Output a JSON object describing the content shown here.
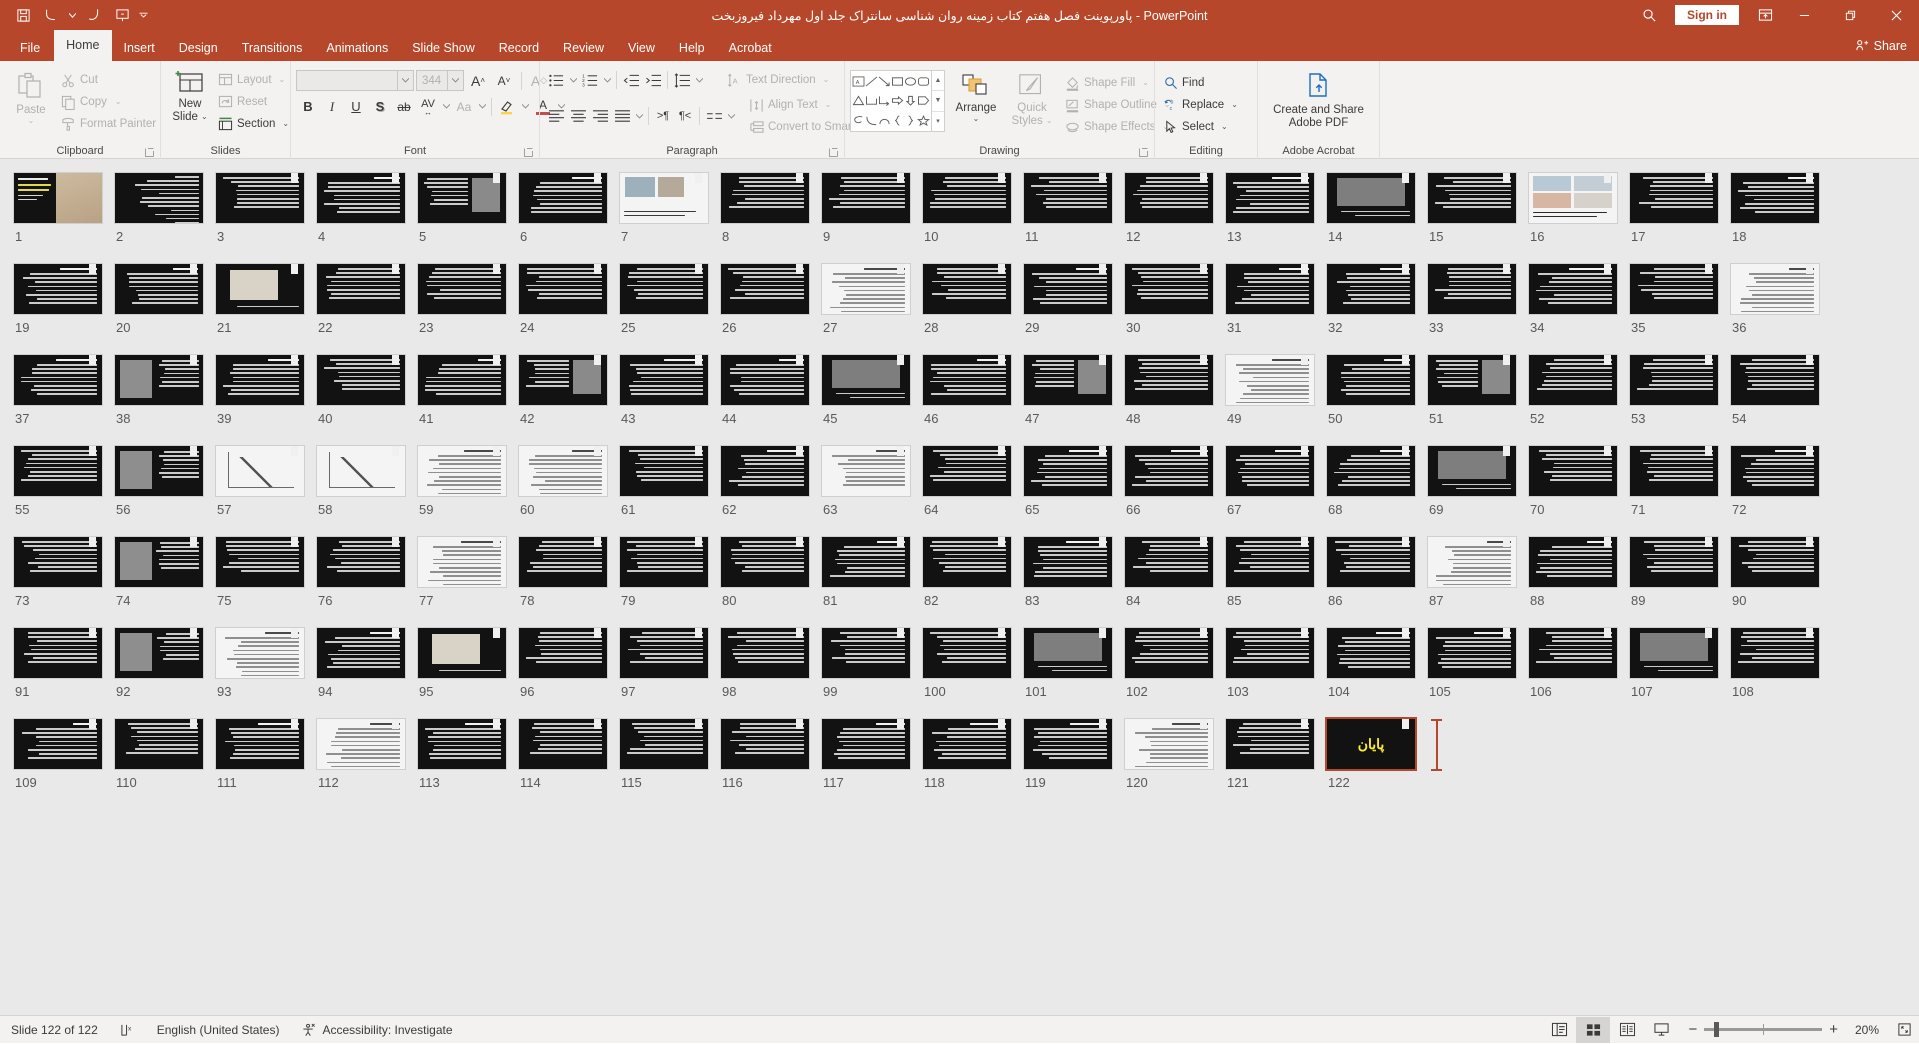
{
  "titlebar": {
    "document_title": "پاورپوینت فصل هفتم کتاب زمینه روان شناسی سانتراک جلد اول مهرداد فیروزبخت  -  PowerPoint",
    "quick_access": [
      {
        "name": "save",
        "icon": "save-icon"
      },
      {
        "name": "undo",
        "icon": "undo-icon"
      },
      {
        "name": "redo",
        "icon": "redo-icon"
      },
      {
        "name": "start-from-beginning",
        "icon": "slideshow-icon"
      },
      {
        "name": "customize-quick-access-toolbar",
        "icon": "chevron-down-icon"
      }
    ],
    "search_label": "search-icon",
    "signin_label": "Sign in",
    "ribbon_display_options": "ribbon-display-icon",
    "minimize": "—",
    "restore": "restore-icon",
    "close": "✕"
  },
  "tabs": [
    {
      "label": "File",
      "active": false
    },
    {
      "label": "Home",
      "active": true
    },
    {
      "label": "Insert",
      "active": false
    },
    {
      "label": "Design",
      "active": false
    },
    {
      "label": "Transitions",
      "active": false
    },
    {
      "label": "Animations",
      "active": false
    },
    {
      "label": "Slide Show",
      "active": false
    },
    {
      "label": "Record",
      "active": false
    },
    {
      "label": "Review",
      "active": false
    },
    {
      "label": "View",
      "active": false
    },
    {
      "label": "Help",
      "active": false
    },
    {
      "label": "Acrobat",
      "active": false
    }
  ],
  "share_label": "Share",
  "ribbon": {
    "clipboard": {
      "group_label": "Clipboard",
      "paste_label": "Paste",
      "cut_label": "Cut",
      "copy_label": "Copy",
      "format_painter_label": "Format Painter"
    },
    "slides": {
      "group_label": "Slides",
      "new_slide_line1": "New",
      "new_slide_line2": "Slide",
      "layout_label": "Layout",
      "reset_label": "Reset",
      "section_label": "Section"
    },
    "font": {
      "group_label": "Font",
      "font_name_value": "",
      "font_name_placeholder": "",
      "font_size_value": "344",
      "increase_font_label": "A",
      "decrease_font_label": "A",
      "clear_formatting_label": "A",
      "bold_label": "B",
      "italic_label": "I",
      "underline_label": "U",
      "shadow_label": "S",
      "strikethrough_label": "ab",
      "character_spacing_label": "AV",
      "change_case_label": "Aa",
      "highlight_label": "A",
      "font_color_label": "A"
    },
    "paragraph": {
      "group_label": "Paragraph",
      "text_direction_label": "Text Direction",
      "align_text_label": "Align Text",
      "convert_smartart_label": "Convert to SmartArt"
    },
    "drawing": {
      "group_label": "Drawing",
      "arrange_label": "Arrange",
      "quick_styles_line1": "Quick",
      "quick_styles_line2": "Styles",
      "shape_fill_label": "Shape Fill",
      "shape_outline_label": "Shape Outline",
      "shape_effects_label": "Shape Effects"
    },
    "editing": {
      "group_label": "Editing",
      "find_label": "Find",
      "replace_label": "Replace",
      "select_label": "Select"
    },
    "acrobat": {
      "group_label": "Adobe Acrobat",
      "create_share_line1": "Create and Share",
      "create_share_line2": "Adobe PDF"
    }
  },
  "statusbar": {
    "slide_counter": "Slide 122 of 122",
    "language": "English (United States)",
    "accessibility": "Accessibility: Investigate",
    "zoom_level": "20%",
    "views": [
      {
        "name": "normal-view",
        "active": false
      },
      {
        "name": "slide-sorter-view",
        "active": true
      },
      {
        "name": "reading-view",
        "active": false
      },
      {
        "name": "slide-show-view",
        "active": false
      }
    ]
  },
  "slides": {
    "total": 122,
    "selected": 122,
    "end_slide_text": "پایان",
    "items": [
      {
        "n": 1,
        "style": "title-cover"
      },
      {
        "n": 2,
        "style": "dark-dense"
      },
      {
        "n": 3,
        "style": "dark-text"
      },
      {
        "n": 4,
        "style": "dark-text"
      },
      {
        "n": 5,
        "style": "dark-photo-right"
      },
      {
        "n": 6,
        "style": "dark-text"
      },
      {
        "n": 7,
        "style": "light-photo"
      },
      {
        "n": 8,
        "style": "dark-text"
      },
      {
        "n": 9,
        "style": "dark-text"
      },
      {
        "n": 10,
        "style": "dark-text"
      },
      {
        "n": 11,
        "style": "dark-text"
      },
      {
        "n": 12,
        "style": "dark-text"
      },
      {
        "n": 13,
        "style": "dark-text"
      },
      {
        "n": 14,
        "style": "dark-photo-wide"
      },
      {
        "n": 15,
        "style": "dark-text"
      },
      {
        "n": 16,
        "style": "light-photo-grid"
      },
      {
        "n": 17,
        "style": "dark-text"
      },
      {
        "n": 18,
        "style": "dark-text"
      },
      {
        "n": 19,
        "style": "dark-text"
      },
      {
        "n": 20,
        "style": "dark-text"
      },
      {
        "n": 21,
        "style": "dark-chart"
      },
      {
        "n": 22,
        "style": "dark-text"
      },
      {
        "n": 23,
        "style": "dark-text"
      },
      {
        "n": 24,
        "style": "dark-text"
      },
      {
        "n": 25,
        "style": "dark-text"
      },
      {
        "n": 26,
        "style": "dark-text"
      },
      {
        "n": 27,
        "style": "light-doc"
      },
      {
        "n": 28,
        "style": "dark-text"
      },
      {
        "n": 29,
        "style": "dark-text"
      },
      {
        "n": 30,
        "style": "dark-text"
      },
      {
        "n": 31,
        "style": "dark-text"
      },
      {
        "n": 32,
        "style": "dark-text"
      },
      {
        "n": 33,
        "style": "dark-text"
      },
      {
        "n": 34,
        "style": "dark-text"
      },
      {
        "n": 35,
        "style": "dark-text"
      },
      {
        "n": 36,
        "style": "light-doc"
      },
      {
        "n": 37,
        "style": "dark-text"
      },
      {
        "n": 38,
        "style": "dark-photo-left"
      },
      {
        "n": 39,
        "style": "dark-text"
      },
      {
        "n": 40,
        "style": "dark-text"
      },
      {
        "n": 41,
        "style": "dark-text"
      },
      {
        "n": 42,
        "style": "dark-photo-right"
      },
      {
        "n": 43,
        "style": "dark-text"
      },
      {
        "n": 44,
        "style": "dark-text"
      },
      {
        "n": 45,
        "style": "dark-photo-wide"
      },
      {
        "n": 46,
        "style": "dark-text"
      },
      {
        "n": 47,
        "style": "dark-photo-right"
      },
      {
        "n": 48,
        "style": "dark-text"
      },
      {
        "n": 49,
        "style": "light-doc"
      },
      {
        "n": 50,
        "style": "dark-text"
      },
      {
        "n": 51,
        "style": "dark-photo-right"
      },
      {
        "n": 52,
        "style": "dark-text"
      },
      {
        "n": 53,
        "style": "dark-text"
      },
      {
        "n": 54,
        "style": "dark-text"
      },
      {
        "n": 55,
        "style": "dark-text"
      },
      {
        "n": 56,
        "style": "dark-photo-left"
      },
      {
        "n": 57,
        "style": "light-chart"
      },
      {
        "n": 58,
        "style": "light-chart"
      },
      {
        "n": 59,
        "style": "light-doc"
      },
      {
        "n": 60,
        "style": "light-doc"
      },
      {
        "n": 61,
        "style": "dark-text"
      },
      {
        "n": 62,
        "style": "dark-text"
      },
      {
        "n": 63,
        "style": "light-table"
      },
      {
        "n": 64,
        "style": "dark-text"
      },
      {
        "n": 65,
        "style": "dark-text"
      },
      {
        "n": 66,
        "style": "dark-text"
      },
      {
        "n": 67,
        "style": "dark-text"
      },
      {
        "n": 68,
        "style": "dark-text"
      },
      {
        "n": 69,
        "style": "dark-photo-wide"
      },
      {
        "n": 70,
        "style": "dark-text"
      },
      {
        "n": 71,
        "style": "dark-text"
      },
      {
        "n": 72,
        "style": "dark-text"
      },
      {
        "n": 73,
        "style": "dark-text"
      },
      {
        "n": 74,
        "style": "dark-photo-left"
      },
      {
        "n": 75,
        "style": "dark-text"
      },
      {
        "n": 76,
        "style": "dark-text"
      },
      {
        "n": 77,
        "style": "light-doc"
      },
      {
        "n": 78,
        "style": "dark-text"
      },
      {
        "n": 79,
        "style": "dark-text"
      },
      {
        "n": 80,
        "style": "dark-text"
      },
      {
        "n": 81,
        "style": "dark-text"
      },
      {
        "n": 82,
        "style": "dark-text"
      },
      {
        "n": 83,
        "style": "dark-text"
      },
      {
        "n": 84,
        "style": "dark-text"
      },
      {
        "n": 85,
        "style": "dark-text"
      },
      {
        "n": 86,
        "style": "dark-text"
      },
      {
        "n": 87,
        "style": "light-doc"
      },
      {
        "n": 88,
        "style": "dark-text"
      },
      {
        "n": 89,
        "style": "dark-text"
      },
      {
        "n": 90,
        "style": "dark-text"
      },
      {
        "n": 91,
        "style": "dark-text"
      },
      {
        "n": 92,
        "style": "dark-photo-left"
      },
      {
        "n": 93,
        "style": "light-doc"
      },
      {
        "n": 94,
        "style": "dark-text"
      },
      {
        "n": 95,
        "style": "dark-chart"
      },
      {
        "n": 96,
        "style": "dark-text"
      },
      {
        "n": 97,
        "style": "dark-text"
      },
      {
        "n": 98,
        "style": "dark-text"
      },
      {
        "n": 99,
        "style": "dark-text"
      },
      {
        "n": 100,
        "style": "dark-text"
      },
      {
        "n": 101,
        "style": "dark-photo-wide"
      },
      {
        "n": 102,
        "style": "dark-text"
      },
      {
        "n": 103,
        "style": "dark-text"
      },
      {
        "n": 104,
        "style": "dark-text"
      },
      {
        "n": 105,
        "style": "dark-text"
      },
      {
        "n": 106,
        "style": "dark-text"
      },
      {
        "n": 107,
        "style": "dark-photo-wide"
      },
      {
        "n": 108,
        "style": "dark-text"
      },
      {
        "n": 109,
        "style": "dark-text"
      },
      {
        "n": 110,
        "style": "dark-text"
      },
      {
        "n": 111,
        "style": "dark-text"
      },
      {
        "n": 112,
        "style": "light-doc"
      },
      {
        "n": 113,
        "style": "dark-text"
      },
      {
        "n": 114,
        "style": "dark-text"
      },
      {
        "n": 115,
        "style": "dark-text"
      },
      {
        "n": 116,
        "style": "dark-text"
      },
      {
        "n": 117,
        "style": "dark-text"
      },
      {
        "n": 118,
        "style": "dark-text"
      },
      {
        "n": 119,
        "style": "dark-text"
      },
      {
        "n": 120,
        "style": "light-doc"
      },
      {
        "n": 121,
        "style": "dark-text"
      },
      {
        "n": 122,
        "style": "end-slide"
      }
    ]
  }
}
